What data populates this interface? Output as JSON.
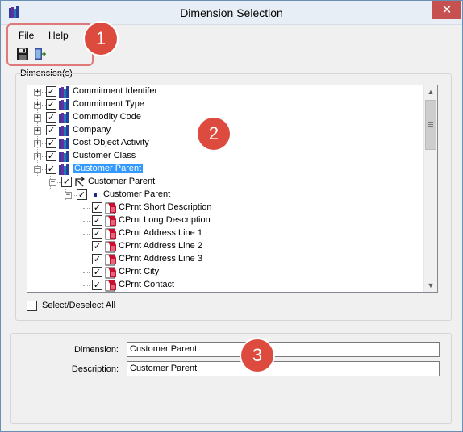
{
  "window": {
    "title": "Dimension Selection",
    "close_glyph": "✕"
  },
  "menu": {
    "file": "File",
    "help": "Help"
  },
  "toolbar": {
    "save_icon": "floppy-disk-icon",
    "exit_icon": "exit-door-icon"
  },
  "callouts": [
    "1",
    "2",
    "3"
  ],
  "dimensions_group": {
    "label": "Dimension(s)",
    "tree": [
      {
        "label": "Commitment Identifer",
        "expander": "+",
        "checked": "✓",
        "icon": "dimension-icon"
      },
      {
        "label": "Commitment Type",
        "expander": "+",
        "checked": "✓",
        "icon": "dimension-icon"
      },
      {
        "label": "Commodity Code",
        "expander": "+",
        "checked": "✓",
        "icon": "dimension-icon"
      },
      {
        "label": "Company",
        "expander": "+",
        "checked": "✓",
        "icon": "dimension-icon"
      },
      {
        "label": "Cost Object Activity",
        "expander": "+",
        "checked": "✓",
        "icon": "dimension-icon"
      },
      {
        "label": "Customer Class",
        "expander": "+",
        "checked": "✓",
        "icon": "dimension-icon"
      },
      {
        "label": "Customer Parent",
        "expander": "−",
        "checked": "✓",
        "icon": "dimension-icon",
        "selected": true
      },
      {
        "label": "Customer Parent",
        "expander": "−",
        "checked": "✓",
        "icon": "hierarchy-icon"
      },
      {
        "label": "Customer Parent",
        "expander": "−",
        "checked": "✓",
        "icon": "level-icon"
      },
      {
        "label": "CPrnt Short Description",
        "checked": "✓",
        "icon": "attribute-icon"
      },
      {
        "label": "CPrnt Long Description",
        "checked": "✓",
        "icon": "attribute-icon"
      },
      {
        "label": "CPrnt Address Line 1",
        "checked": "✓",
        "icon": "attribute-icon"
      },
      {
        "label": "CPrnt Address Line 2",
        "checked": "✓",
        "icon": "attribute-icon"
      },
      {
        "label": "CPrnt Address Line 3",
        "checked": "✓",
        "icon": "attribute-icon"
      },
      {
        "label": "CPrnt City",
        "checked": "✓",
        "icon": "attribute-icon"
      },
      {
        "label": "CPrnt Contact",
        "checked": "✓",
        "icon": "attribute-icon"
      }
    ],
    "scroll_up": "▲",
    "scroll_down": "▼",
    "select_all_label": "Select/Deselect All"
  },
  "details": {
    "dimension_label": "Dimension:",
    "dimension_value": "Customer Parent",
    "description_label": "Description:",
    "description_value": "Customer Parent"
  },
  "colors": {
    "selection": "#3399ff",
    "callout": "#dc4b3e",
    "close": "#c75050"
  }
}
